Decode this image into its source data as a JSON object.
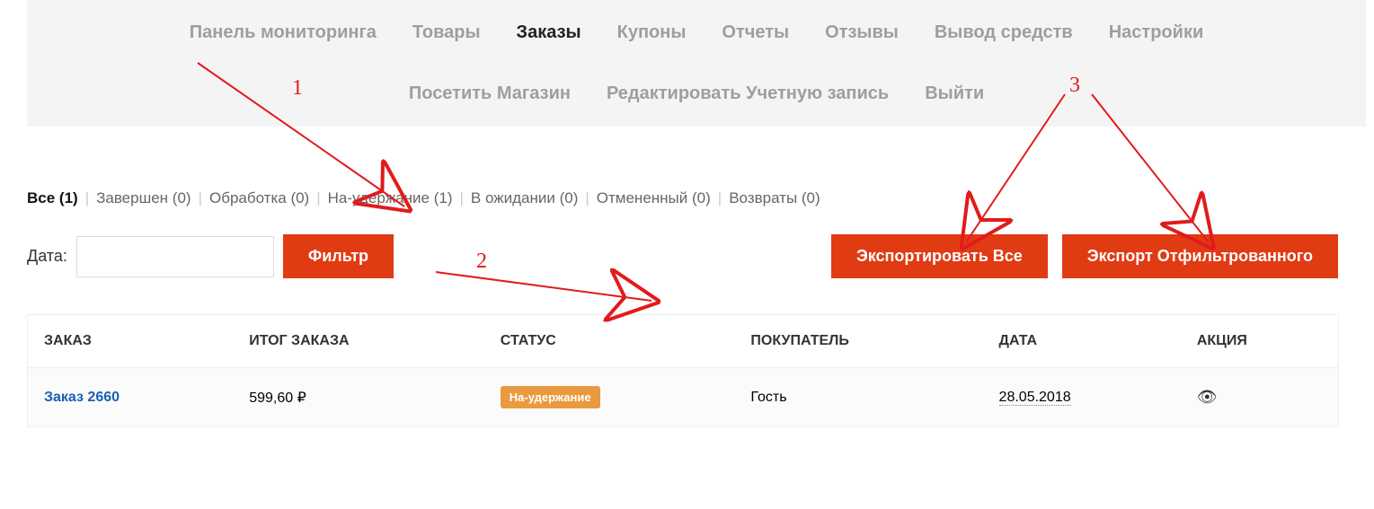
{
  "nav": {
    "row1": [
      {
        "label": "Панель мониторинга",
        "active": false
      },
      {
        "label": "Товары",
        "active": false
      },
      {
        "label": "Заказы",
        "active": true
      },
      {
        "label": "Купоны",
        "active": false
      },
      {
        "label": "Отчеты",
        "active": false
      },
      {
        "label": "Отзывы",
        "active": false
      },
      {
        "label": "Вывод средств",
        "active": false
      },
      {
        "label": "Настройки",
        "active": false
      }
    ],
    "row2": [
      {
        "label": "Посетить Магазин",
        "active": false
      },
      {
        "label": "Редактировать Учетную запись",
        "active": false
      },
      {
        "label": "Выйти",
        "active": false
      }
    ]
  },
  "status_tabs": [
    {
      "label": "Все (1)",
      "active": true
    },
    {
      "label": "Завершен (0)",
      "active": false
    },
    {
      "label": "Обработка (0)",
      "active": false
    },
    {
      "label": "На-удержание (1)",
      "active": false
    },
    {
      "label": "В ожидании (0)",
      "active": false
    },
    {
      "label": "Отмененный (0)",
      "active": false
    },
    {
      "label": "Возвраты (0)",
      "active": false
    }
  ],
  "filter": {
    "date_label": "Дата:",
    "date_value": "",
    "date_placeholder": "",
    "filter_btn": "Фильтр",
    "export_all_btn": "Экспортировать Все",
    "export_filtered_btn": "Экспорт Отфильтрованного"
  },
  "table": {
    "headers": {
      "order": "ЗАКАЗ",
      "total": "ИТОГ ЗАКАЗА",
      "status": "СТАТУС",
      "customer": "ПОКУПАТЕЛЬ",
      "date": "ДАТА",
      "action": "АКЦИЯ"
    },
    "rows": [
      {
        "order": "Заказ 2660",
        "total": "599,60 ₽",
        "status": "На-удержание",
        "customer": "Гость",
        "date": "28.05.2018"
      }
    ]
  },
  "annotations": {
    "n1": "1",
    "n2": "2",
    "n3": "3"
  }
}
